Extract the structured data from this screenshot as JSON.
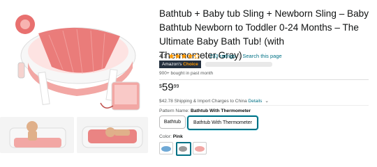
{
  "product": {
    "title": "Bathtub + Baby tub Sling + Newborn Sling – Baby Bathtub Newborn to Toddler 0-24 Months – The Ultimate Baby Bath Tub! (with Thermometer,Gray)",
    "rating_value": "4.3",
    "ratings_link": "233 ratings",
    "separator": "|",
    "search_link": "Search this page",
    "badge_prefix": "Amazon's",
    "badge_suffix": "Choice",
    "bought": "900+ bought in past month",
    "price_currency": "$",
    "price_whole": "59",
    "price_fraction": "99",
    "shipping_text": "$42.78 Shipping & Import Charges to China",
    "details_link": "Details",
    "pattern_label": "Pattern Name:",
    "pattern_value": "Bathtub With Thermometer",
    "pattern_options": [
      "Bathtub",
      "Bathtub With Thermometer"
    ],
    "color_label": "Color:",
    "color_value": "Pink"
  },
  "colors": {
    "link": "#007185",
    "star": "#ff9900",
    "tub_pink": "#f2a7a4",
    "tub_white": "#f7f7f7",
    "sling_red": "#e8706f"
  },
  "icons": {
    "star": "star-icon",
    "chevron": "chevron-down-icon"
  }
}
